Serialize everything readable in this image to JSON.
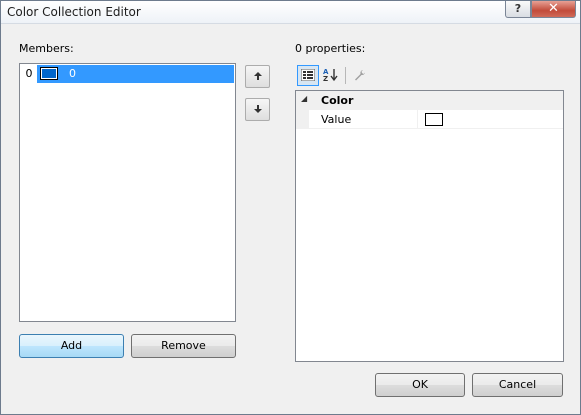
{
  "window": {
    "title": "Color Collection Editor",
    "help_label": "?",
    "close_label": "✕"
  },
  "members": {
    "label": "Members:",
    "items": [
      {
        "index": "0",
        "value": "0",
        "color": "#0066cc",
        "selected": true
      }
    ],
    "move_up_icon": "up-arrow-icon",
    "move_down_icon": "down-arrow-icon"
  },
  "buttons": {
    "add": "Add",
    "remove": "Remove",
    "ok": "OK",
    "cancel": "Cancel"
  },
  "properties": {
    "label": "0 properties:",
    "category": "Color",
    "rows": [
      {
        "name": "Value",
        "color": "#ffffff"
      }
    ]
  }
}
